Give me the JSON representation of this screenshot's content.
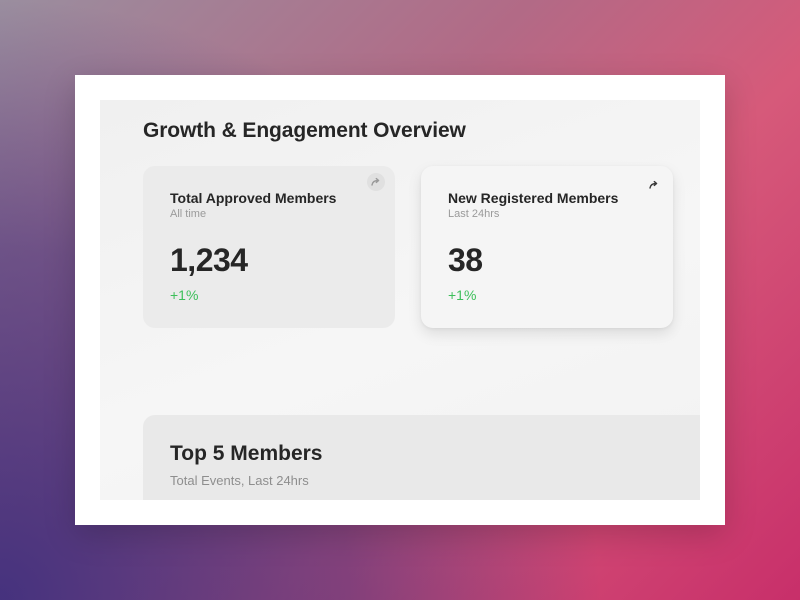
{
  "page": {
    "title": "Growth & Engagement Overview"
  },
  "cards": [
    {
      "title": "Total Approved Members",
      "subtitle": "All time",
      "value": "1,234",
      "change": "+1%",
      "icon": "share-arrow-icon"
    },
    {
      "title": "New Registered Members",
      "subtitle": "Last 24hrs",
      "value": "38",
      "change": "+1%",
      "icon": "share-arrow-icon"
    }
  ],
  "top_members": {
    "title": "Top 5 Members",
    "subtitle": "Total Events, Last 24hrs"
  },
  "colors": {
    "text_primary": "#262626",
    "text_secondary": "#9a9a9a",
    "positive_change": "#3dbf5a",
    "card_background": "#ebebeb",
    "page_background": "#f3f3f3"
  }
}
